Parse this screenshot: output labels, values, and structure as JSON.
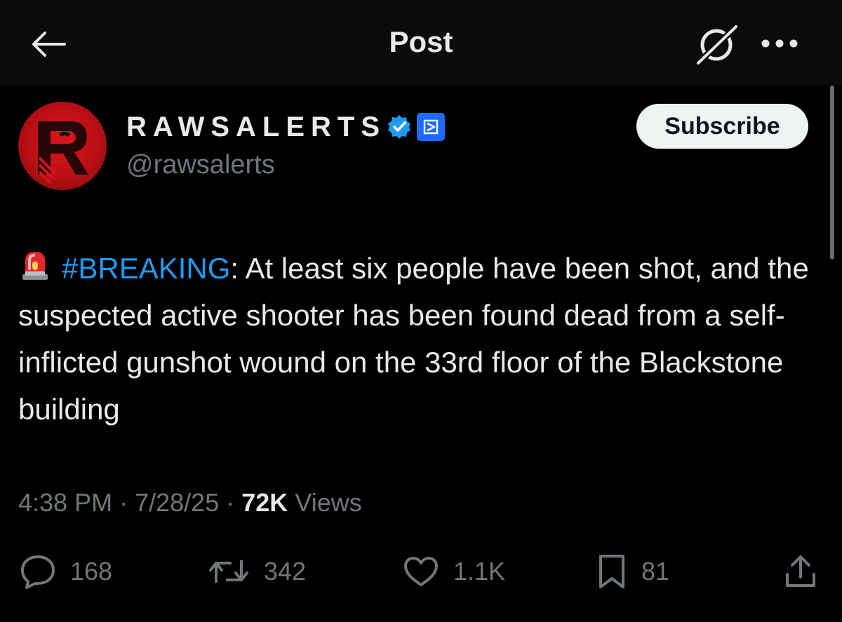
{
  "header": {
    "title": "Post",
    "back_icon": "arrow-left-icon",
    "grok_icon": "grok-icon",
    "more_icon": "more-horizontal-icon"
  },
  "author": {
    "display_name": "RAWSALERTS",
    "handle": "@rawsalerts",
    "verified_icon": "verified-badge-icon",
    "affiliate_icon": "affiliate-badge-icon",
    "avatar_color": "#c8101a",
    "verified_color": "#1d9bf0",
    "affiliate_color": "#1d6bff"
  },
  "subscribe_label": "Subscribe",
  "post": {
    "emoji": "🚨",
    "hashtag": "#BREAKING",
    "text": ": At least six people have been shot, and the suspected active shooter has been found dead from a self-inflicted gunshot wound on the 33rd floor of the Blackstone building",
    "hashtag_color": "#1d9bf0"
  },
  "meta": {
    "time": "4:38 PM",
    "date": "7/28/25",
    "separator": "·",
    "views_count": "72K",
    "views_label": "Views"
  },
  "actions": {
    "replies": "168",
    "reposts": "342",
    "likes": "1.1K",
    "bookmarks": "81"
  },
  "colors": {
    "background": "#000000",
    "text": "#e7e9ea",
    "muted": "#71767b",
    "accent": "#1d9bf0"
  }
}
